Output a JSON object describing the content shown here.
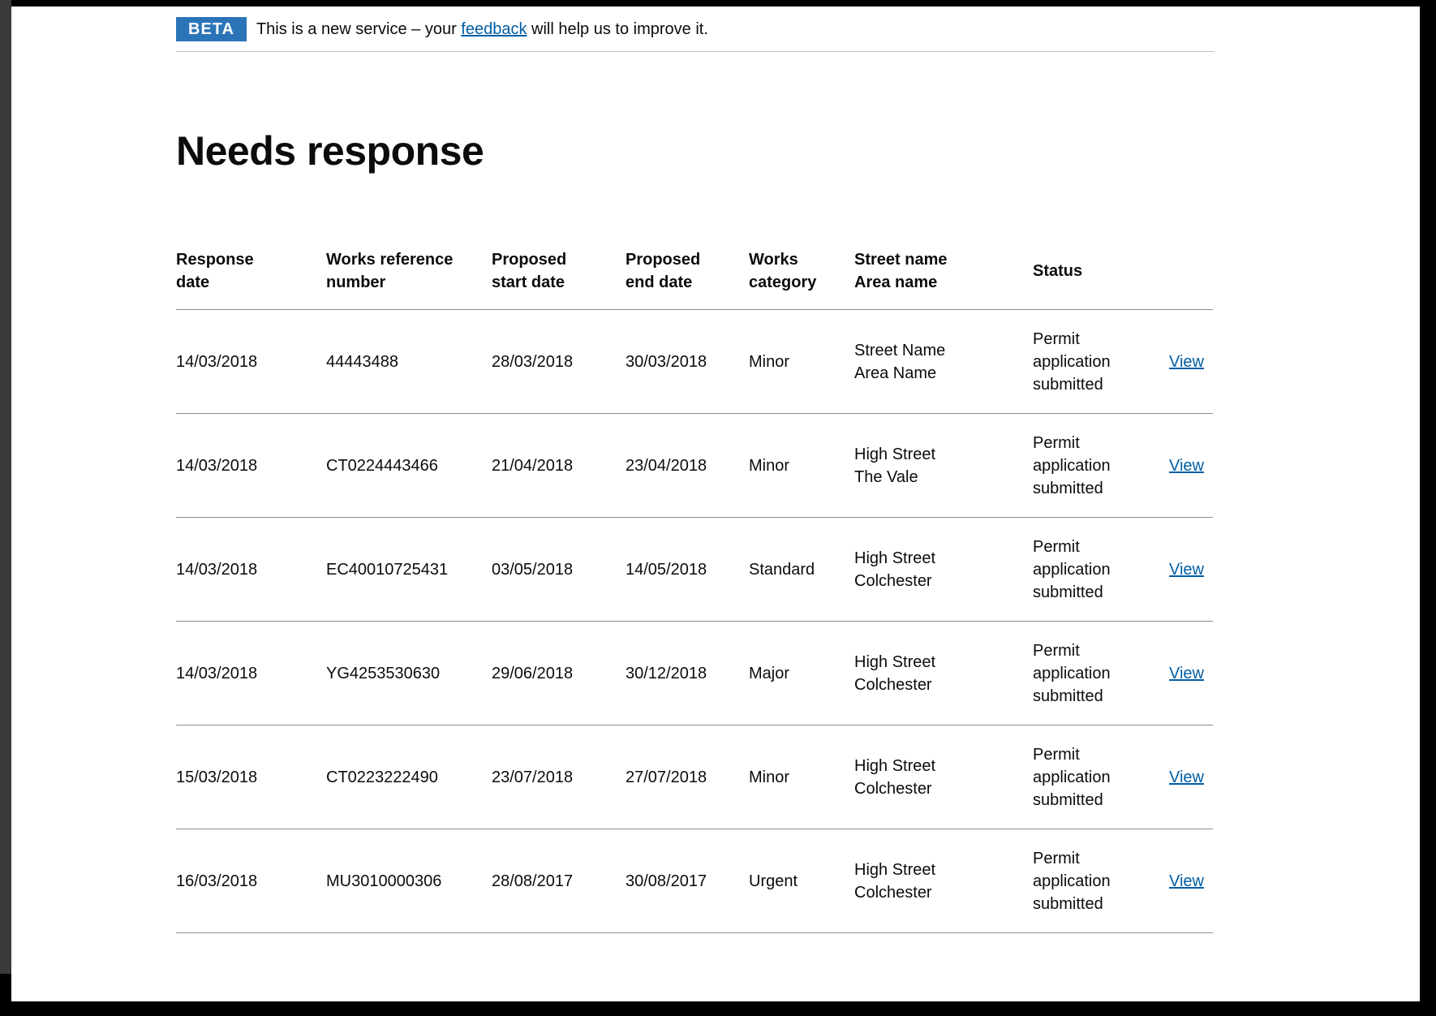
{
  "phase_banner": {
    "tag": "BETA",
    "text_before": "This is a new service – your ",
    "link_text": "feedback",
    "text_after": " will help us to improve it."
  },
  "page_title": "Needs response",
  "table": {
    "headers": {
      "response_date": [
        "Response",
        "date"
      ],
      "works_ref": [
        "Works reference",
        "number"
      ],
      "start_date": [
        "Proposed",
        "start date"
      ],
      "end_date": [
        "Proposed",
        "end date"
      ],
      "category": [
        "Works",
        "category"
      ],
      "street": [
        "Street name",
        "Area name"
      ],
      "status": "Status"
    },
    "rows": [
      {
        "response_date": "14/03/2018",
        "works_ref": "44443488",
        "start_date": "28/03/2018",
        "end_date": "30/03/2018",
        "category": "Minor",
        "street": "Street Name",
        "area": "Area Name",
        "status": [
          "Permit",
          "application",
          "submitted"
        ],
        "action": "View"
      },
      {
        "response_date": "14/03/2018",
        "works_ref": "CT0224443466",
        "start_date": "21/04/2018",
        "end_date": "23/04/2018",
        "category": "Minor",
        "street": "High Street",
        "area": "The Vale",
        "status": [
          "Permit",
          "application",
          "submitted"
        ],
        "action": "View"
      },
      {
        "response_date": "14/03/2018",
        "works_ref": "EC40010725431",
        "start_date": "03/05/2018",
        "end_date": "14/05/2018",
        "category": "Standard",
        "street": "High Street",
        "area": "Colchester",
        "status": [
          "Permit",
          "application",
          "submitted"
        ],
        "action": "View"
      },
      {
        "response_date": "14/03/2018",
        "works_ref": "YG4253530630",
        "start_date": "29/06/2018",
        "end_date": "30/12/2018",
        "category": "Major",
        "street": "High Street",
        "area": "Colchester",
        "status": [
          "Permit",
          "application",
          "submitted"
        ],
        "action": "View"
      },
      {
        "response_date": "15/03/2018",
        "works_ref": "CT0223222490",
        "start_date": "23/07/2018",
        "end_date": "27/07/2018",
        "category": "Minor",
        "street": "High Street",
        "area": "Colchester",
        "status": [
          "Permit",
          "application",
          "submitted"
        ],
        "action": "View"
      },
      {
        "response_date": "16/03/2018",
        "works_ref": "MU3010000306",
        "start_date": "28/08/2017",
        "end_date": "30/08/2017",
        "category": "Urgent",
        "street": "High Street",
        "area": "Colchester",
        "status": [
          "Permit",
          "application",
          "submitted"
        ],
        "action": "View"
      }
    ]
  },
  "colors": {
    "beta_tag": "#2b74b8",
    "link": "#005ea5",
    "text": "#0b0c0c",
    "border": "#8a8c8e"
  }
}
